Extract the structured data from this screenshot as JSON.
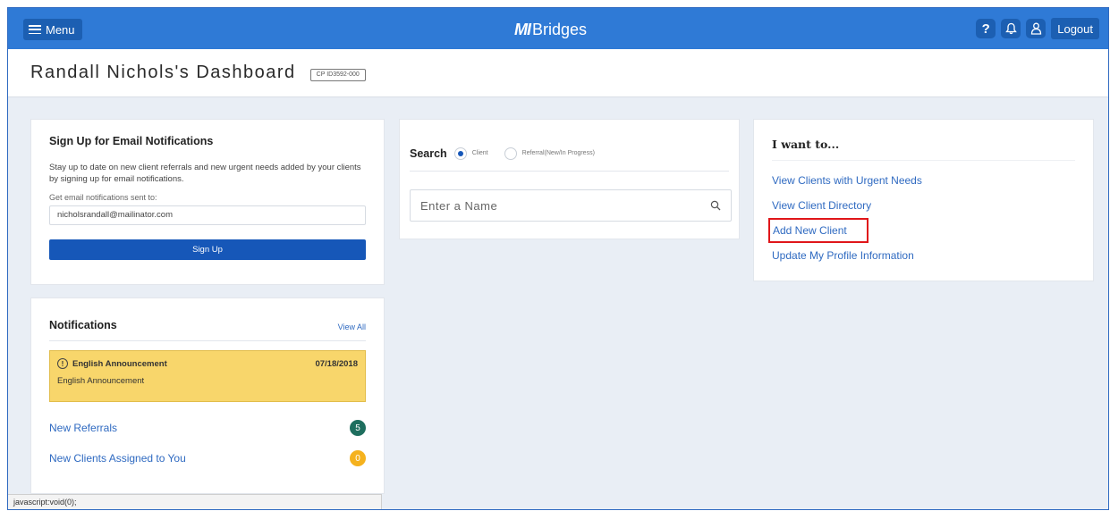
{
  "topbar": {
    "menu_label": "Menu",
    "brand_mark": "MI",
    "brand_name": "Bridges",
    "help_label": "?",
    "logout_label": "Logout"
  },
  "header": {
    "title": "Randall Nichols's Dashboard",
    "cp_id": "CP ID3592-000"
  },
  "email_card": {
    "title": "Sign Up for Email Notifications",
    "description": "Stay up to date on new client referrals and new urgent needs added by your clients by signing up for email notifications.",
    "label": "Get email notifications sent to:",
    "email_value": "nicholsrandall@mailinator.com",
    "button_label": "Sign Up"
  },
  "notifications": {
    "title": "Notifications",
    "view_all": "View All",
    "announcement": {
      "title": "English Announcement",
      "date": "07/18/2018",
      "body": "English Announcement"
    },
    "items": [
      {
        "label": "New Referrals",
        "count": "5",
        "color": "#1e6e5e"
      },
      {
        "label": "New Clients Assigned to You",
        "count": "0",
        "color": "#f5b21e"
      }
    ]
  },
  "search": {
    "label": "Search",
    "option_client": "Client",
    "option_referral": "Referral(New/In Progress)",
    "selected": "Client",
    "placeholder": "Enter a Name"
  },
  "iwant": {
    "title": "I want to...",
    "links": [
      "View Clients with Urgent Needs",
      "View Client Directory",
      "Add New Client",
      "Update My Profile Information"
    ],
    "highlighted_index": 2
  },
  "status_bar": "javascript:void(0);",
  "colors": {
    "topbar": "#2f7ad6",
    "primary_button": "#1657b8",
    "link": "#2f6ac1",
    "announcement": "#f8d66b",
    "highlight_box": "#e0161a"
  }
}
